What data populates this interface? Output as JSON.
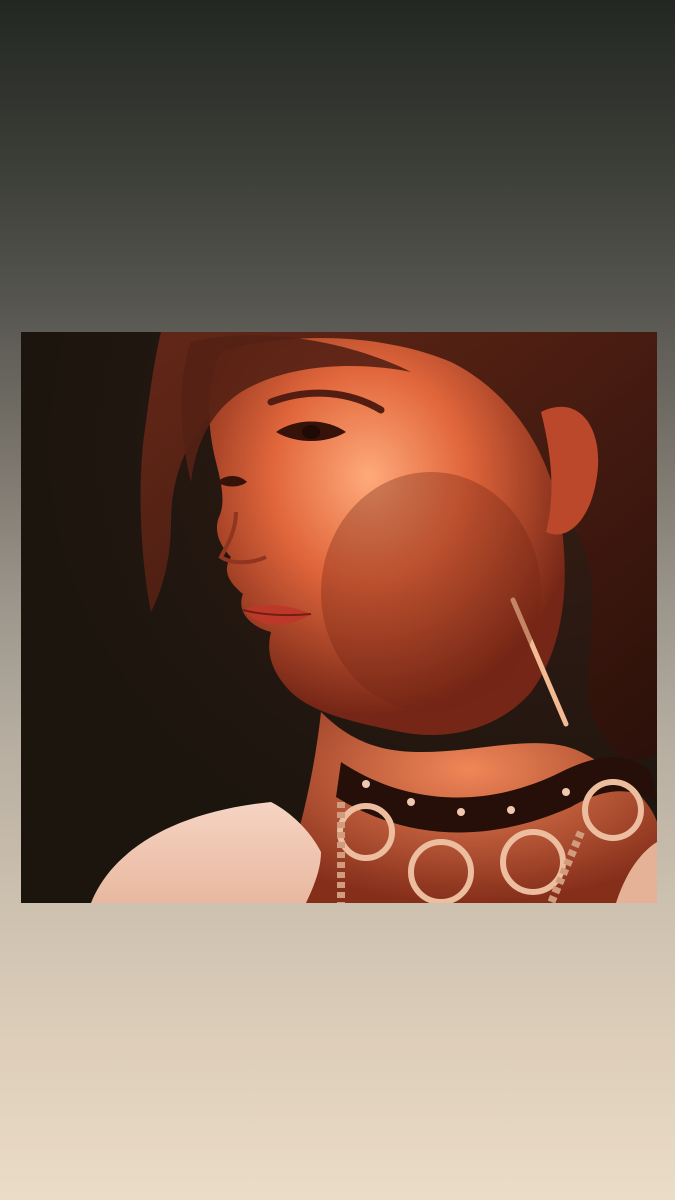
{
  "story": {
    "background_gradient": [
      "#232722",
      "#585751",
      "#9b958b",
      "#cbbfae",
      "#ebdcc8"
    ],
    "photo": {
      "subject": "portrait-red-lighting",
      "palette": {
        "backdrop": "#10140f",
        "skin_light": "#ff9a6a",
        "skin_mid": "#d8603c",
        "skin_shadow": "#7a2a1c",
        "hair": "#3a1a12",
        "choker": "#1a0c0a",
        "metal": "#e9c2a8",
        "top": "#f3d6c8"
      }
    }
  }
}
